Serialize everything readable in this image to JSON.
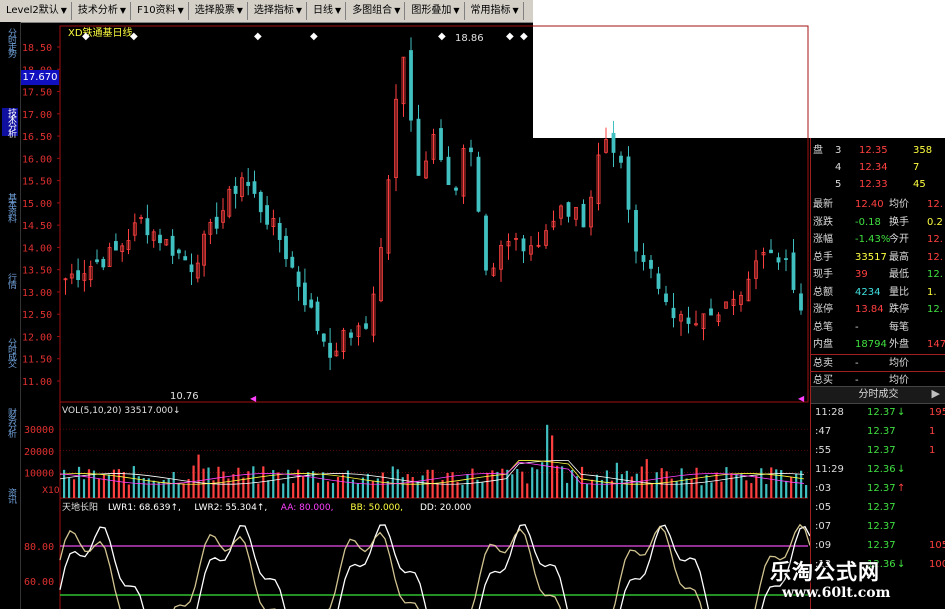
{
  "toolbar": {
    "items": [
      {
        "label": "Level2默认"
      },
      {
        "label": "技术分析"
      },
      {
        "label": "F10资料"
      },
      {
        "label": "选择股票"
      },
      {
        "label": "选择指标"
      },
      {
        "label": "日线"
      },
      {
        "label": "多图组合"
      },
      {
        "label": "图形叠加"
      },
      {
        "label": "常用指标"
      }
    ]
  },
  "left_nav": [
    {
      "label": "分时走势",
      "top": 0
    },
    {
      "label": "技术分析",
      "top": 80
    },
    {
      "label": "基本资料",
      "top": 165
    },
    {
      "label": "行情",
      "top": 245
    },
    {
      "label": "分时成交",
      "top": 310
    },
    {
      "label": "财务分析",
      "top": 380
    },
    {
      "label": "资讯",
      "top": 460
    }
  ],
  "price_chart": {
    "title": "XD铁通基日线",
    "current_price_tag": "17.670",
    "high_label": "18.86",
    "low_label": "10.76",
    "y_ticks": [
      "18.50",
      "18.00",
      "17.50",
      "17.00",
      "16.50",
      "16.00",
      "15.50",
      "15.00",
      "14.50",
      "14.00",
      "13.50",
      "13.00",
      "12.50",
      "12.00",
      "11.50",
      "11.00"
    ]
  },
  "volume_chart": {
    "legend": "VOL(5,10,20) 33517.000↓",
    "y_ticks": [
      "30000",
      "20000",
      "10000"
    ],
    "unit": "X10"
  },
  "indicator_chart": {
    "name": "天地长阳",
    "legend_parts": [
      {
        "text": "LWR1: 68.639↑,",
        "color": "#ffffff"
      },
      {
        "text": "LWR2: 55.304↑,",
        "color": "#ffffff"
      },
      {
        "text": "AA: 80.000,",
        "color": "#ff40ff"
      },
      {
        "text": "BB: 50.000,",
        "color": "#ffff40"
      },
      {
        "text": "DD: 20.000",
        "color": "#ffffff"
      }
    ],
    "y_ticks": [
      "80.00",
      "60.00",
      "40.00"
    ]
  },
  "quote_panel": {
    "order_book": [
      {
        "side": "盘",
        "level": "3",
        "price": "12.35",
        "vol": "358"
      },
      {
        "side": "",
        "level": "4",
        "price": "12.34",
        "vol": "7"
      },
      {
        "side": "",
        "level": "5",
        "price": "12.33",
        "vol": "45"
      }
    ],
    "stats": [
      {
        "l1": "最新",
        "v1": "12.40",
        "c1": "red",
        "l2": "均价",
        "v2": "12.",
        "c2": "red"
      },
      {
        "l1": "涨跌",
        "v1": "-0.18",
        "c1": "green",
        "l2": "换手",
        "v2": "0.2",
        "c2": "yellow"
      },
      {
        "l1": "涨幅",
        "v1": "-1.43%",
        "c1": "green",
        "l2": "今开",
        "v2": "12.",
        "c2": "red"
      },
      {
        "l1": "总手",
        "v1": "33517",
        "c1": "yellow",
        "l2": "最高",
        "v2": "12.",
        "c2": "red"
      },
      {
        "l1": "现手",
        "v1": "39",
        "c1": "red",
        "l2": "最低",
        "v2": "12.",
        "c2": "green"
      },
      {
        "l1": "总额",
        "v1": "4234",
        "c1": "cyan",
        "l2": "量比",
        "v2": "1.",
        "c2": "yellow"
      },
      {
        "l1": "涨停",
        "v1": "13.84",
        "c1": "red",
        "l2": "跌停",
        "v2": "12.",
        "c2": "green"
      },
      {
        "l1": "总笔",
        "v1": "-",
        "c1": "white",
        "l2": "每笔",
        "v2": "",
        "c2": "white"
      },
      {
        "l1": "内盘",
        "v1": "18794",
        "c1": "green",
        "l2": "外盘",
        "v2": "147",
        "c2": "red"
      },
      {
        "l1": "总卖",
        "v1": "-",
        "c1": "white",
        "l2": "均价",
        "v2": "",
        "c2": "white"
      },
      {
        "l1": "总买",
        "v1": "-",
        "c1": "white",
        "l2": "均价",
        "v2": "",
        "c2": "white"
      }
    ],
    "tick_header": "分时成交",
    "ticks": [
      {
        "time": "11:28",
        "price": "12.37",
        "arrow": "↓",
        "vol": "195"
      },
      {
        "time": ":47",
        "price": "12.37",
        "arrow": "",
        "vol": "1"
      },
      {
        "time": ":55",
        "price": "12.37",
        "arrow": "",
        "vol": "1"
      },
      {
        "time": "11:29",
        "price": "12.36",
        "arrow": "↓",
        "vol": ""
      },
      {
        "time": ":03",
        "price": "12.37",
        "arrow": "↑",
        "vol": ""
      },
      {
        "time": ":05",
        "price": "12.37",
        "arrow": "",
        "vol": ""
      },
      {
        "time": ":07",
        "price": "12.37",
        "arrow": "",
        "vol": ""
      },
      {
        "time": ":09",
        "price": "12.37",
        "arrow": "",
        "vol": "105"
      },
      {
        "time": ":13",
        "price": "12.36",
        "arrow": "↓",
        "vol": "100"
      }
    ]
  },
  "watermark": {
    "line1": "乐淘公式网",
    "line2": "www.60lt.com"
  },
  "colors": {
    "up": "#ff4040",
    "down": "#40c0c0",
    "grid": "#a01010",
    "ma_white": "#ffffff",
    "ma_yellow": "#ffff40",
    "ma_pink": "#ff40ff"
  }
}
